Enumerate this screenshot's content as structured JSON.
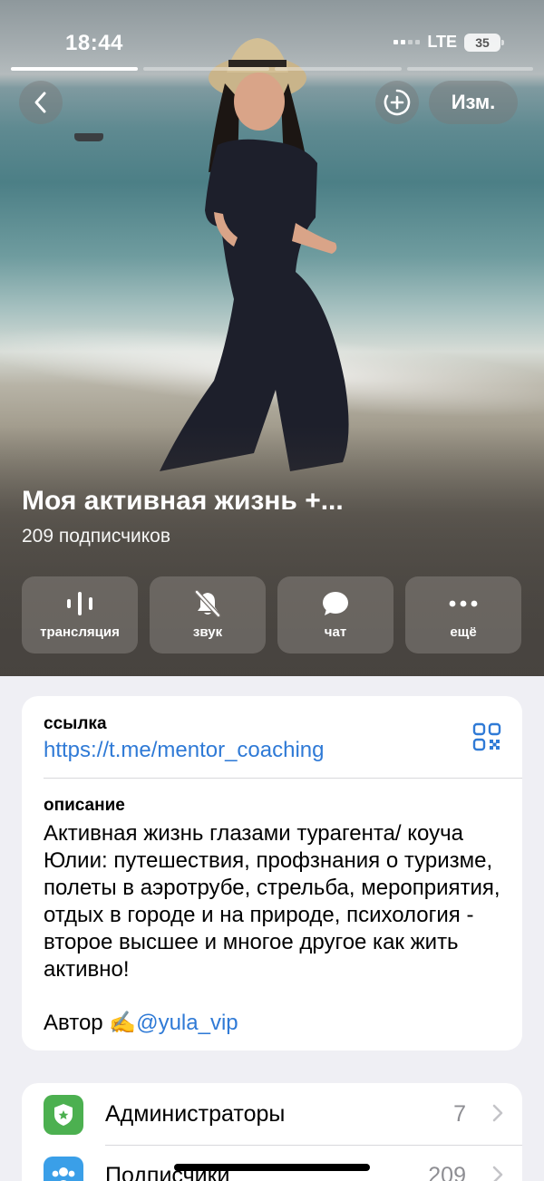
{
  "status_bar": {
    "time": "18:44",
    "network": "LTE",
    "battery": "35"
  },
  "story_progress": {
    "segments": 4,
    "active_index": 0
  },
  "header": {
    "back_icon": "chevron-left-icon",
    "add_icon": "add-story-icon",
    "edit_label": "Изм."
  },
  "channel": {
    "title": "Моя активная жизнь +...",
    "subscribers": "209 подписчиков"
  },
  "actions": [
    {
      "label": "трансляция",
      "icon": "live-stream-icon"
    },
    {
      "label": "звук",
      "icon": "bell-muted-icon"
    },
    {
      "label": "чат",
      "icon": "chat-bubble-icon"
    },
    {
      "label": "ещё",
      "icon": "more-dots-icon"
    }
  ],
  "info": {
    "link_label": "ссылка",
    "link_value": "https://t.me/mentor_coaching",
    "qr_icon": "qr-code-icon",
    "description_label": "описание",
    "description_text": "Активная жизнь глазами турагента/ коуча Юлии: путешествия, профзнания о туризме, полеты в аэротрубе, стрельба, мероприятия, отдых в городе и на природе, психология - второе высшее и многое другое как жить активно!",
    "author_prefix": "Автор ✍️",
    "author_mention": "@yula_vip"
  },
  "list": [
    {
      "label": "Администраторы",
      "value": "7",
      "icon": "shield-badge-icon",
      "color": "#4cb050"
    },
    {
      "label": "Подписчики",
      "value": "209",
      "icon": "people-icon",
      "color": "#3a9fe8"
    }
  ],
  "colors": {
    "link": "#2f7ad6",
    "background": "#efeff4"
  }
}
